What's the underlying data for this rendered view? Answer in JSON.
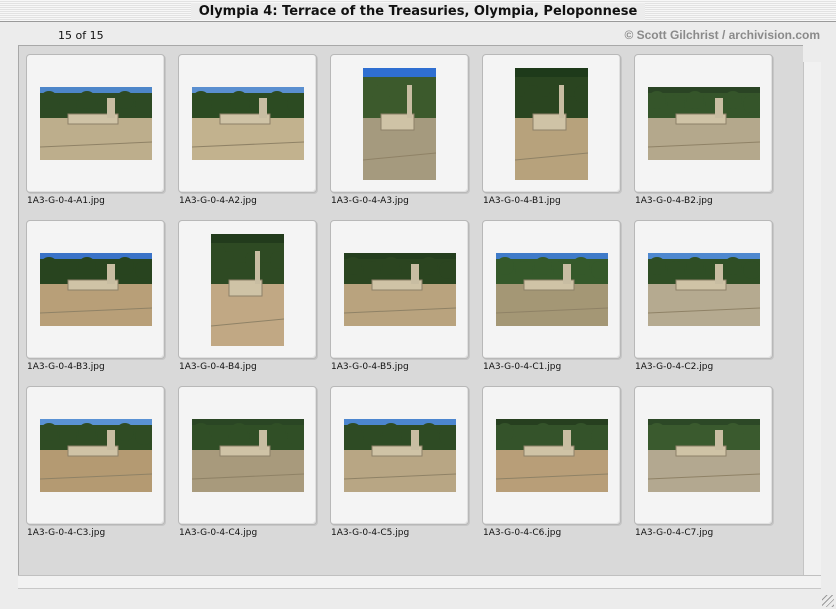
{
  "window": {
    "title": "Olympia 4: Terrace of the Treasuries, Olympia, Peloponnese"
  },
  "toolbar": {
    "counter": "15 of 15",
    "copyright": "© Scott Gilchrist / archivision.com"
  },
  "gallery": {
    "items": [
      {
        "caption": "1A3-G-0-4-A1.jpg",
        "orientation": "landscape",
        "sky": "#4d86c9",
        "trees": "#2d4a24",
        "ground": "#bdae8c"
      },
      {
        "caption": "1A3-G-0-4-A2.jpg",
        "orientation": "landscape",
        "sky": "#5a8fd0",
        "trees": "#2c4b22",
        "ground": "#c2b28e"
      },
      {
        "caption": "1A3-G-0-4-A3.jpg",
        "orientation": "portrait",
        "sky": "#2f6fd1",
        "trees": "#3c5a2c",
        "ground": "#a59a7e"
      },
      {
        "caption": "1A3-G-0-4-B1.jpg",
        "orientation": "portrait",
        "sky": "#1e3a1a",
        "trees": "#2a4520",
        "ground": "#b7a27c"
      },
      {
        "caption": "1A3-G-0-4-B2.jpg",
        "orientation": "landscape",
        "sky": "#2a4424",
        "trees": "#35552a",
        "ground": "#b4a88c"
      },
      {
        "caption": "1A3-G-0-4-B3.jpg",
        "orientation": "landscape",
        "sky": "#3a73c8",
        "trees": "#28441f",
        "ground": "#b89f78"
      },
      {
        "caption": "1A3-G-0-4-B4.jpg",
        "orientation": "portrait",
        "sky": "#223b1c",
        "trees": "#2e4a23",
        "ground": "#c1a884"
      },
      {
        "caption": "1A3-G-0-4-B5.jpg",
        "orientation": "landscape",
        "sky": "#243e1e",
        "trees": "#2b4520",
        "ground": "#b9a37e"
      },
      {
        "caption": "1A3-G-0-4-C1.jpg",
        "orientation": "landscape",
        "sky": "#3f7bc9",
        "trees": "#35592a",
        "ground": "#a49775"
      },
      {
        "caption": "1A3-G-0-4-C2.jpg",
        "orientation": "landscape",
        "sky": "#4e88cf",
        "trees": "#2f4e25",
        "ground": "#b5aa90"
      },
      {
        "caption": "1A3-G-0-4-C3.jpg",
        "orientation": "landscape",
        "sky": "#5a92d4",
        "trees": "#2f4c24",
        "ground": "#b49a72"
      },
      {
        "caption": "1A3-G-0-4-C4.jpg",
        "orientation": "landscape",
        "sky": "#2a4624",
        "trees": "#304f26",
        "ground": "#a89a7c"
      },
      {
        "caption": "1A3-G-0-4-C5.jpg",
        "orientation": "landscape",
        "sky": "#4c86cf",
        "trees": "#2e4b24",
        "ground": "#b8a684"
      },
      {
        "caption": "1A3-G-0-4-C6.jpg",
        "orientation": "landscape",
        "sky": "#263f1f",
        "trees": "#34532a",
        "ground": "#b89e78"
      },
      {
        "caption": "1A3-G-0-4-C7.jpg",
        "orientation": "landscape",
        "sky": "#2c4826",
        "trees": "#3a5a2e",
        "ground": "#b3a890"
      }
    ]
  }
}
